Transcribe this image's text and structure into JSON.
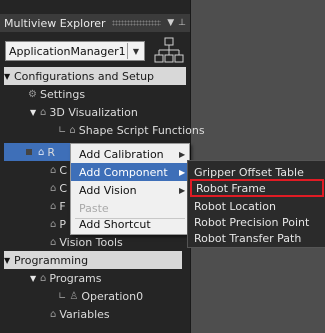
{
  "panel": {
    "title": "Multiview Explorer",
    "pin_icon": "pin-icon",
    "menu_icon": "chevron-down-icon"
  },
  "app_selector": {
    "value": "ApplicationManager1"
  },
  "tree": {
    "configurations": "Configurations and Setup",
    "settings": "Settings",
    "visualization": "3D Visualization",
    "shape_script": "Shape Script Functions",
    "row_r": "R",
    "row_c1": "C",
    "row_c2": "C",
    "row_f": "F",
    "row_p": "P",
    "vision_tools": "Vision Tools",
    "programming": "Programming",
    "programs": "Programs",
    "operation0": "Operation0",
    "variables": "Variables"
  },
  "context_menu": {
    "items": [
      "Add Calibration",
      "Add Component",
      "Add Vision",
      "Paste",
      "Add Shortcut"
    ]
  },
  "submenu": {
    "items": [
      "Gripper Offset Table",
      "Robot Frame",
      "Robot Location",
      "Robot Precision Point",
      "Robot Transfer Path"
    ]
  },
  "colors": {
    "selection": "#3e6fb8",
    "highlight_box": "#e01b24",
    "workspace": "#4e4e4e"
  }
}
